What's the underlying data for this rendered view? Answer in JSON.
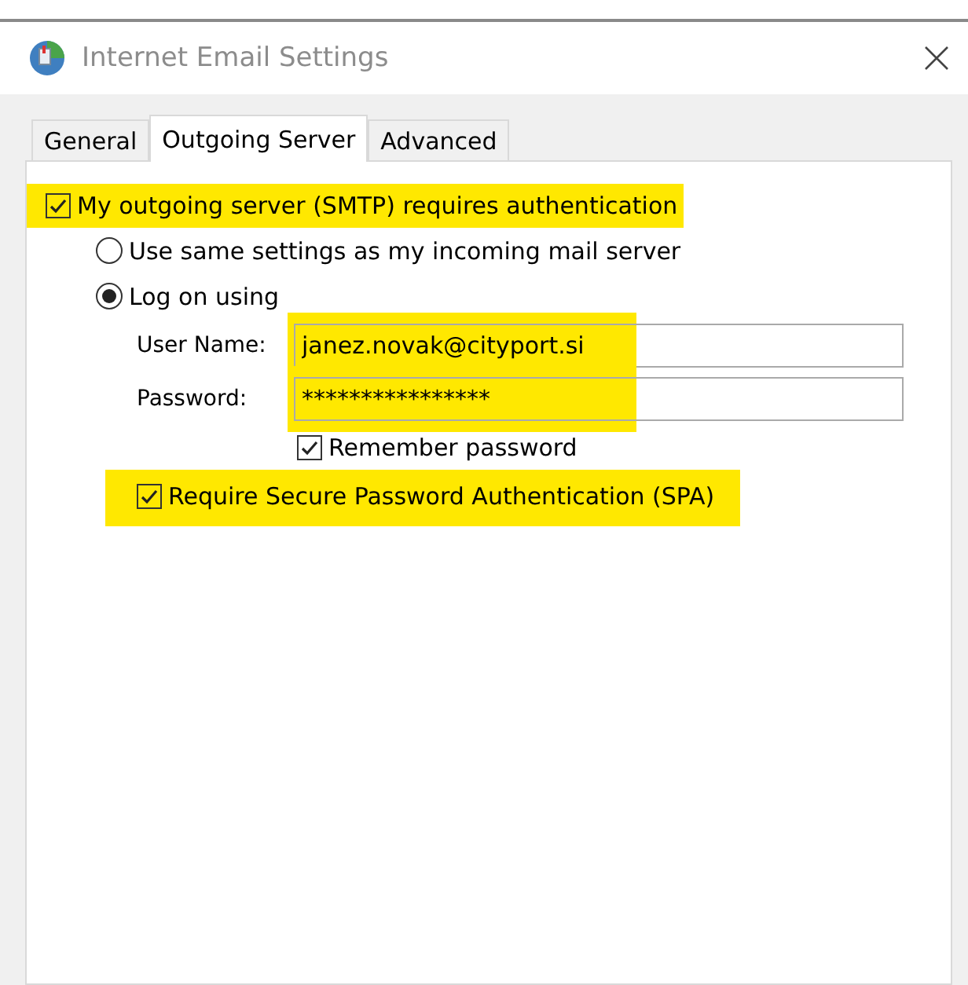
{
  "window": {
    "title": "Internet Email Settings"
  },
  "tabs": [
    {
      "label": "General",
      "selected": false
    },
    {
      "label": "Outgoing Server",
      "selected": true
    },
    {
      "label": "Advanced",
      "selected": false
    }
  ],
  "auth_checkbox": {
    "label": "My outgoing server (SMTP) requires authentication",
    "checked": true,
    "highlighted": true
  },
  "logon_options": [
    {
      "label": "Use same settings as my incoming mail server",
      "selected": false
    },
    {
      "label": "Log on using",
      "selected": true
    }
  ],
  "fields": [
    {
      "label": "User Name:",
      "value": "janez.novak@cityport.si",
      "highlighted": true
    },
    {
      "label": "Password:",
      "value": "****************",
      "highlighted": true
    }
  ],
  "remember_password": {
    "label": "Remember password",
    "checked": true
  },
  "spa_checkbox": {
    "label": "Require Secure Password Authentication (SPA)",
    "checked": true,
    "highlighted": true
  }
}
